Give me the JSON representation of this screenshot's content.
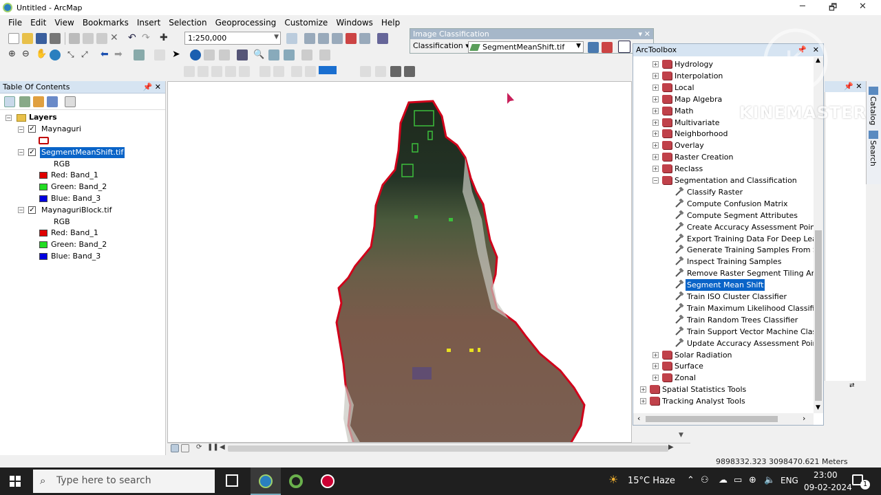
{
  "window": {
    "title": "Untitled - ArcMap",
    "controls": [
      "─",
      "🗗",
      "✕"
    ]
  },
  "menu": [
    "File",
    "Edit",
    "View",
    "Bookmarks",
    "Insert",
    "Selection",
    "Geoprocessing",
    "Customize",
    "Windows",
    "Help"
  ],
  "toolbar": {
    "scale": "1:250,000"
  },
  "image_classification": {
    "title": "Image Classification",
    "classification_label": "Classification ▾",
    "layer": "SegmentMeanShift.tif"
  },
  "toc": {
    "title": "Table Of Contents",
    "layers_label": "Layers",
    "items": [
      {
        "name": "Maynaguri"
      },
      {
        "name": "SegmentMeanShift.tif",
        "rgb": "RGB",
        "red": "Red:   Band_1",
        "green": "Green: Band_2",
        "blue": "Blue:   Band_3"
      },
      {
        "name": "MaynaguriBlock.tif",
        "rgb": "RGB",
        "red": "Red:   Band_1",
        "green": "Green: Band_2",
        "blue": "Blue:   Band_3"
      }
    ],
    "colors": {
      "red": "#e00000",
      "green": "#22dd22",
      "blue": "#0000e0",
      "outline": "#c00000"
    }
  },
  "arctoolbox": {
    "title": "ArcToolbox",
    "toolsets": [
      "Hydrology",
      "Interpolation",
      "Local",
      "Map Algebra",
      "Math",
      "Multivariate",
      "Neighborhood",
      "Overlay",
      "Raster Creation",
      "Reclass",
      "Segmentation and Classification"
    ],
    "seg_tools": [
      "Classify Raster",
      "Compute Confusion Matrix",
      "Compute Segment Attributes",
      "Create Accuracy Assessment Points",
      "Export Training Data For Deep Learni",
      "Generate Training Samples From See",
      "Inspect Training Samples",
      "Remove Raster Segment Tiling Artifa",
      "Segment Mean Shift",
      "Train ISO Cluster Classifier",
      "Train Maximum Likelihood Classifier",
      "Train Random Trees Classifier",
      "Train Support Vector Machine Classi",
      "Update Accuracy Assessment Points"
    ],
    "after_toolsets": [
      "Solar Radiation",
      "Surface",
      "Zonal"
    ],
    "root_toolboxes": [
      "Spatial Statistics Tools",
      "Tracking Analyst Tools"
    ],
    "selected": "Segment Mean Shift"
  },
  "side_tabs": [
    "Catalog",
    "Search"
  ],
  "status": {
    "coords": "9898332.323  3098470.621 Meters"
  },
  "watermark": "KINEMASTER",
  "taskbar": {
    "search_placeholder": "Type here to search",
    "weather": "15°C  Haze",
    "lang": "ENG",
    "time": "23:00",
    "date": "09-02-2024",
    "notif": "1"
  }
}
